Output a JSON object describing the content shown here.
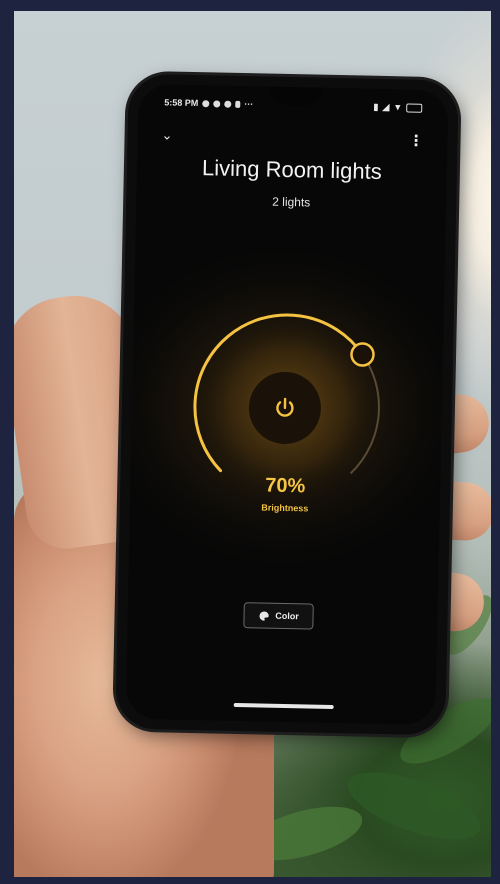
{
  "status_bar": {
    "time": "5:58 PM",
    "left_icons": [
      "sync-icon",
      "alarm-icon",
      "settings-icon",
      "battery-saver-icon",
      "more-dots-icon"
    ],
    "right_icons": [
      "vibrate-icon",
      "signal-icon",
      "wifi-icon",
      "battery-icon"
    ]
  },
  "header": {
    "title": "Living Room lights",
    "subtitle": "2 lights",
    "collapse_icon": "chevron-down-icon",
    "menu_icon": "overflow-menu-icon"
  },
  "brightness": {
    "value_text": "70%",
    "label": "Brightness",
    "level": 0.7,
    "accent_color": "#f5c242"
  },
  "power": {
    "icon": "power-icon"
  },
  "color_button": {
    "label": "Color",
    "icon": "palette-icon"
  }
}
